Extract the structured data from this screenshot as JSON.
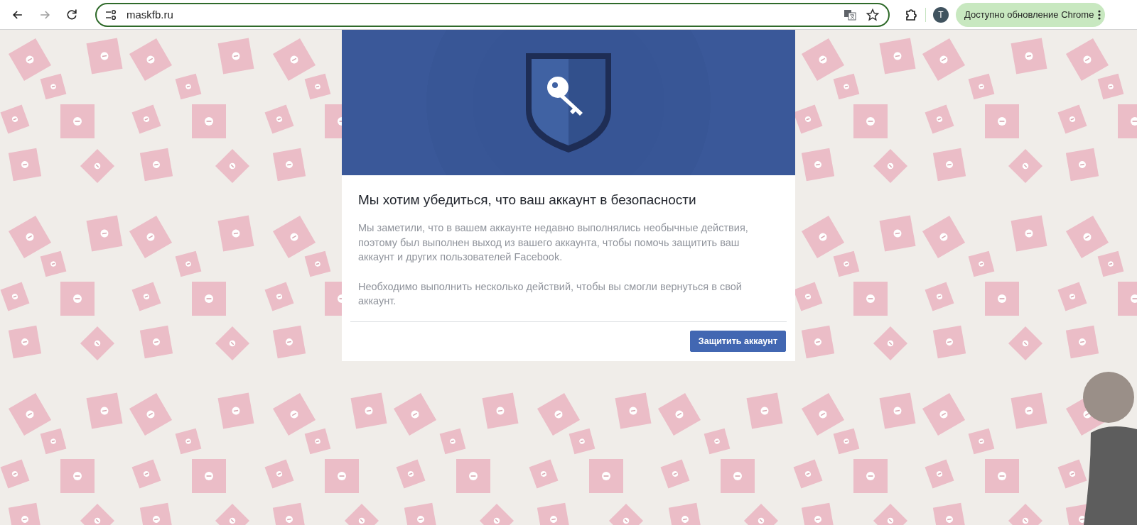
{
  "browser": {
    "nav": [
      {
        "kind": "back",
        "disabled": false
      },
      {
        "kind": "forward",
        "disabled": true
      },
      {
        "kind": "reload",
        "disabled": false
      }
    ],
    "url": "maskfb.ru",
    "avatar_letter": "T",
    "update_button": "Доступно обновление Chrome"
  },
  "card": {
    "title": "Мы хотим убедиться, что ваш аккаунт в безопасности",
    "paragraphs": [
      "Мы заметили, что в вашем аккаунте недавно выполнялись необычные действия, поэтому был выполнен выход из вашего аккаунта, чтобы помочь защитить ваш аккаунт и других пользователей Facebook.",
      "Необходимо выполнить несколько действий, чтобы вы смогли вернуться в свой аккаунт."
    ],
    "button": "Защитить аккаунт"
  }
}
